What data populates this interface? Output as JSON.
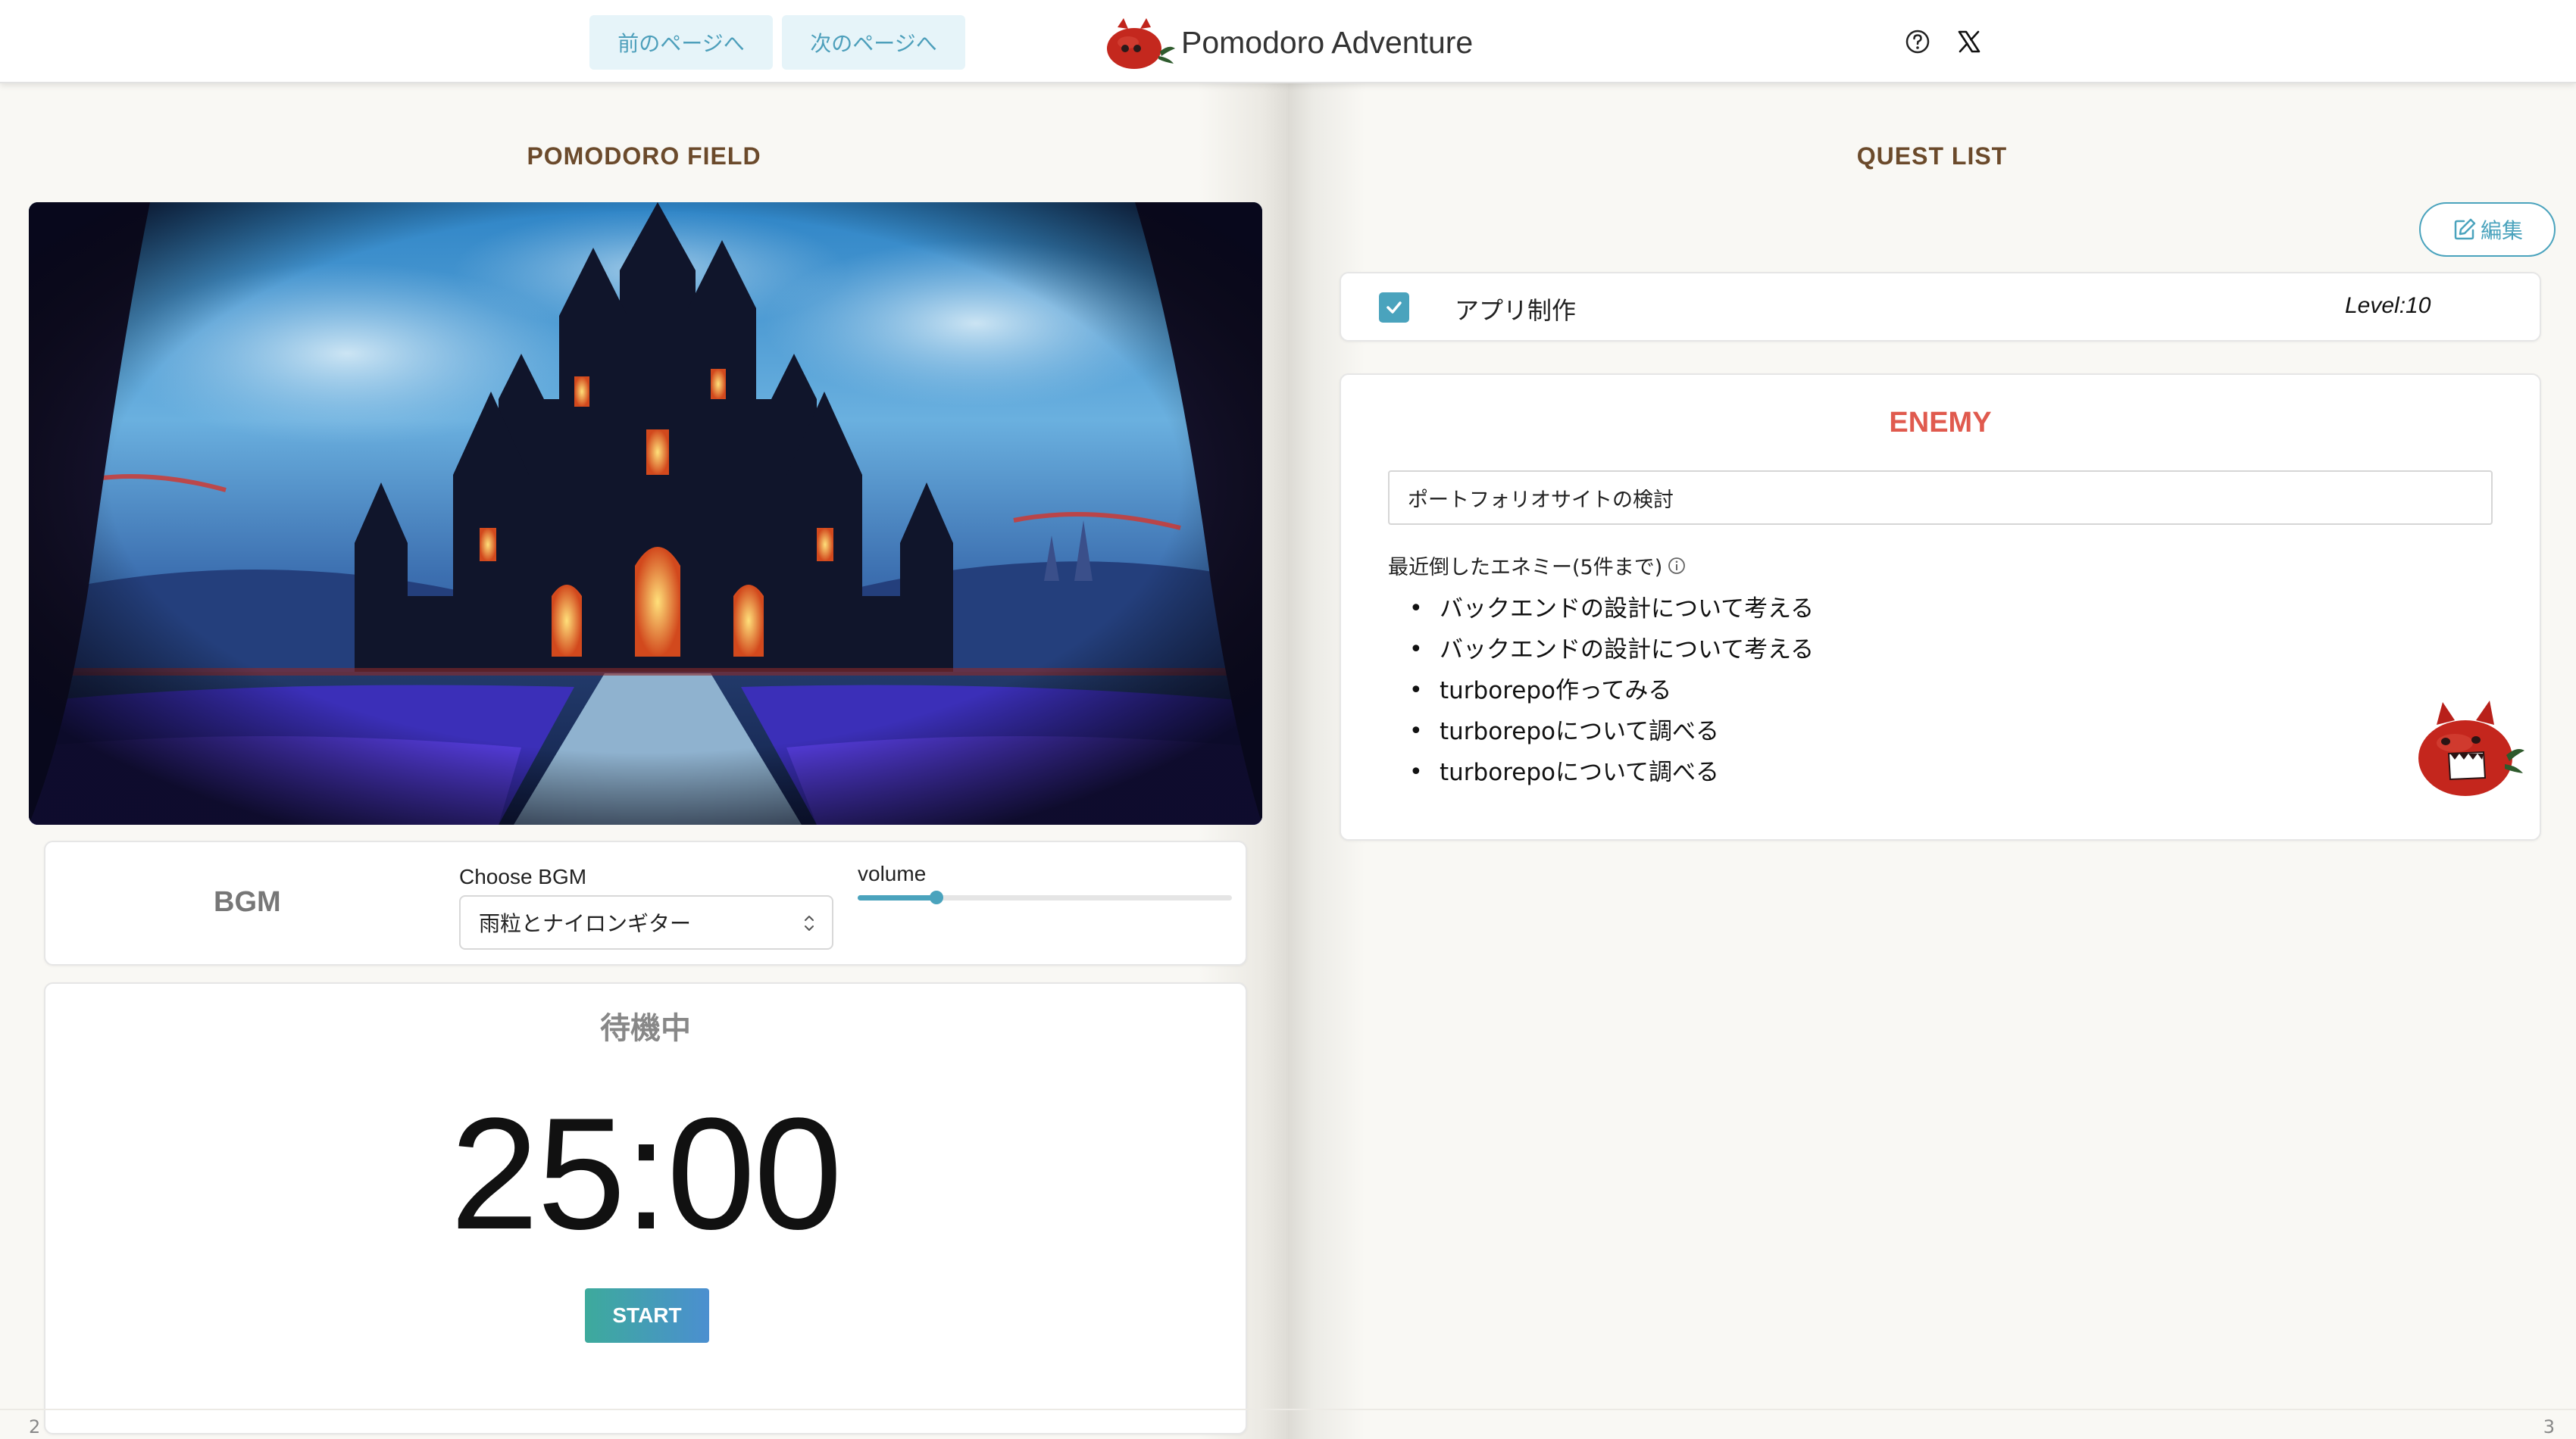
{
  "header": {
    "prev_label": "前のページへ",
    "next_label": "次のページへ",
    "app_title": "Pomodoro Adventure",
    "icons": [
      "help-icon",
      "x-logo-icon"
    ]
  },
  "left_page": {
    "title": "POMODORO FIELD",
    "page_number": "2",
    "bgm": {
      "label": "BGM",
      "choose_label": "Choose BGM",
      "selected": "雨粒とナイロンギター",
      "volume_label": "volume",
      "volume_fraction": 0.21
    },
    "timer": {
      "status": "待機中",
      "time": "25:00",
      "start_label": "START"
    }
  },
  "right_page": {
    "title": "QUEST LIST",
    "page_number": "3",
    "edit_label": "編集",
    "quest": {
      "checked": true,
      "name": "アプリ制作",
      "level": "Level:10"
    },
    "enemy": {
      "title": "ENEMY",
      "current": "ポートフォリオサイトの検討",
      "recent_label": "最近倒したエネミー(5件まで)",
      "recent": [
        "バックエンドの設計について考える",
        "バックエンドの設計について考える",
        "turborepo作ってみる",
        "turborepoについて調べる",
        "turborepoについて調べる"
      ]
    }
  },
  "colors": {
    "accent": "#4aa3bd",
    "enemy": "#e05a4e",
    "title_brown": "#6b4a2b",
    "start_gradient": [
      "#3daa9c",
      "#4b8fd0"
    ]
  }
}
